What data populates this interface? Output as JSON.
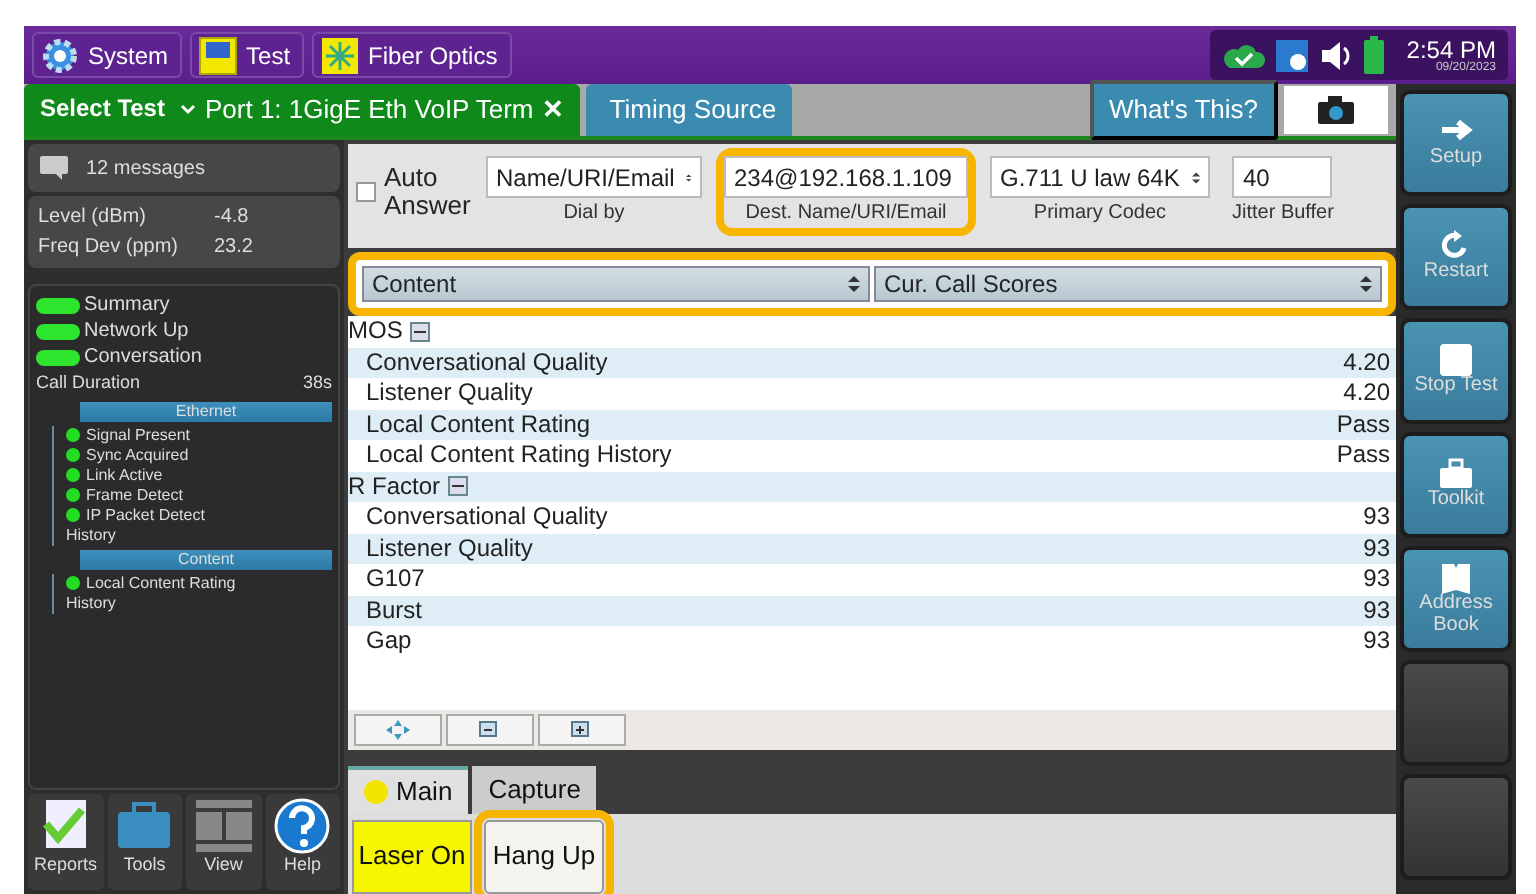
{
  "top_bar": {
    "menus": [
      {
        "label": "System"
      },
      {
        "label": "Test"
      },
      {
        "label": "Fiber Optics"
      }
    ],
    "time": "2:54 PM",
    "date": "09/20/2023"
  },
  "tabs": [
    {
      "label": "Port 1: 1GigE Eth VoIP Term",
      "select_label": "Select Test",
      "close": "✕",
      "selected": true
    },
    {
      "label": "Timing Source",
      "selected": false
    }
  ],
  "whats_this": "What's This?",
  "left_panel": {
    "messages": "12 messages",
    "readings": [
      {
        "label": "Level (dBm)",
        "value": "-4.8"
      },
      {
        "label": "Freq Dev (ppm)",
        "value": "23.2"
      }
    ],
    "status": [
      {
        "label": "Summary",
        "on": true
      },
      {
        "label": "Network Up",
        "on": true
      },
      {
        "label": "Conversation",
        "on": true
      }
    ],
    "call_duration": {
      "label": "Call Duration",
      "value": "38s"
    },
    "sections": [
      {
        "title": "Ethernet",
        "items": [
          {
            "label": "Signal Present",
            "on": true
          },
          {
            "label": "Sync Acquired",
            "on": true
          },
          {
            "label": "Link Active",
            "on": true
          },
          {
            "label": "Frame Detect",
            "on": true
          },
          {
            "label": "IP Packet Detect",
            "on": true
          }
        ],
        "history": "History"
      },
      {
        "title": "Content",
        "items": [
          {
            "label": "Local Content Rating",
            "on": true
          }
        ],
        "history": "History"
      }
    ],
    "tools": [
      {
        "label": "Reports"
      },
      {
        "label": "Tools"
      },
      {
        "label": "View"
      },
      {
        "label": "Help"
      }
    ]
  },
  "form": {
    "auto_answer": {
      "label": "Auto Answer",
      "checked": false
    },
    "fields": [
      {
        "kind": "select",
        "value": "Name/URI/Email",
        "caption": "Dial by",
        "highlighted": false
      },
      {
        "kind": "text",
        "value": "234@192.168.1.109",
        "caption": "Dest. Name/URI/Email",
        "highlighted": true
      },
      {
        "kind": "select",
        "value": "G.711 U law 64K",
        "caption": "Primary Codec",
        "highlighted": false
      },
      {
        "kind": "text",
        "value": "40",
        "caption": "Jitter Buffer",
        "highlighted": false
      }
    ]
  },
  "selectors": {
    "highlighted": true,
    "items": [
      {
        "value": "Content"
      },
      {
        "value": "Cur. Call Scores"
      }
    ]
  },
  "results": [
    {
      "label": "MOS",
      "expanded": true,
      "rows": [
        {
          "label": "Conversational Quality",
          "value": "4.20"
        },
        {
          "label": "Listener Quality",
          "value": "4.20"
        },
        {
          "label": "Local Content Rating",
          "value": "Pass"
        },
        {
          "label": "Local Content Rating History",
          "value": "Pass"
        }
      ]
    },
    {
      "label": "R Factor",
      "expanded": true,
      "rows": [
        {
          "label": "Conversational Quality",
          "value": "93"
        },
        {
          "label": "Listener Quality",
          "value": "93"
        },
        {
          "label": "G107",
          "value": "93"
        },
        {
          "label": "Burst",
          "value": "93"
        },
        {
          "label": "Gap",
          "value": "93"
        }
      ]
    }
  ],
  "bottom_tabs": [
    {
      "label": "Main",
      "selected": true,
      "led": true
    },
    {
      "label": "Capture",
      "selected": false,
      "led": false
    }
  ],
  "actions": [
    {
      "label": "Laser On",
      "on": true,
      "highlighted": false
    },
    {
      "label": "Hang Up",
      "on": false,
      "highlighted": true
    }
  ],
  "side_buttons": [
    {
      "kind": "arrow",
      "label": "Setup"
    },
    {
      "kind": "restart",
      "label": "Restart"
    },
    {
      "kind": "stop",
      "label": "Stop Test"
    },
    {
      "kind": "toolkit",
      "label": "Toolkit"
    },
    {
      "kind": "book",
      "label": "Address Book"
    },
    {
      "kind": "blank"
    },
    {
      "kind": "blank"
    }
  ]
}
